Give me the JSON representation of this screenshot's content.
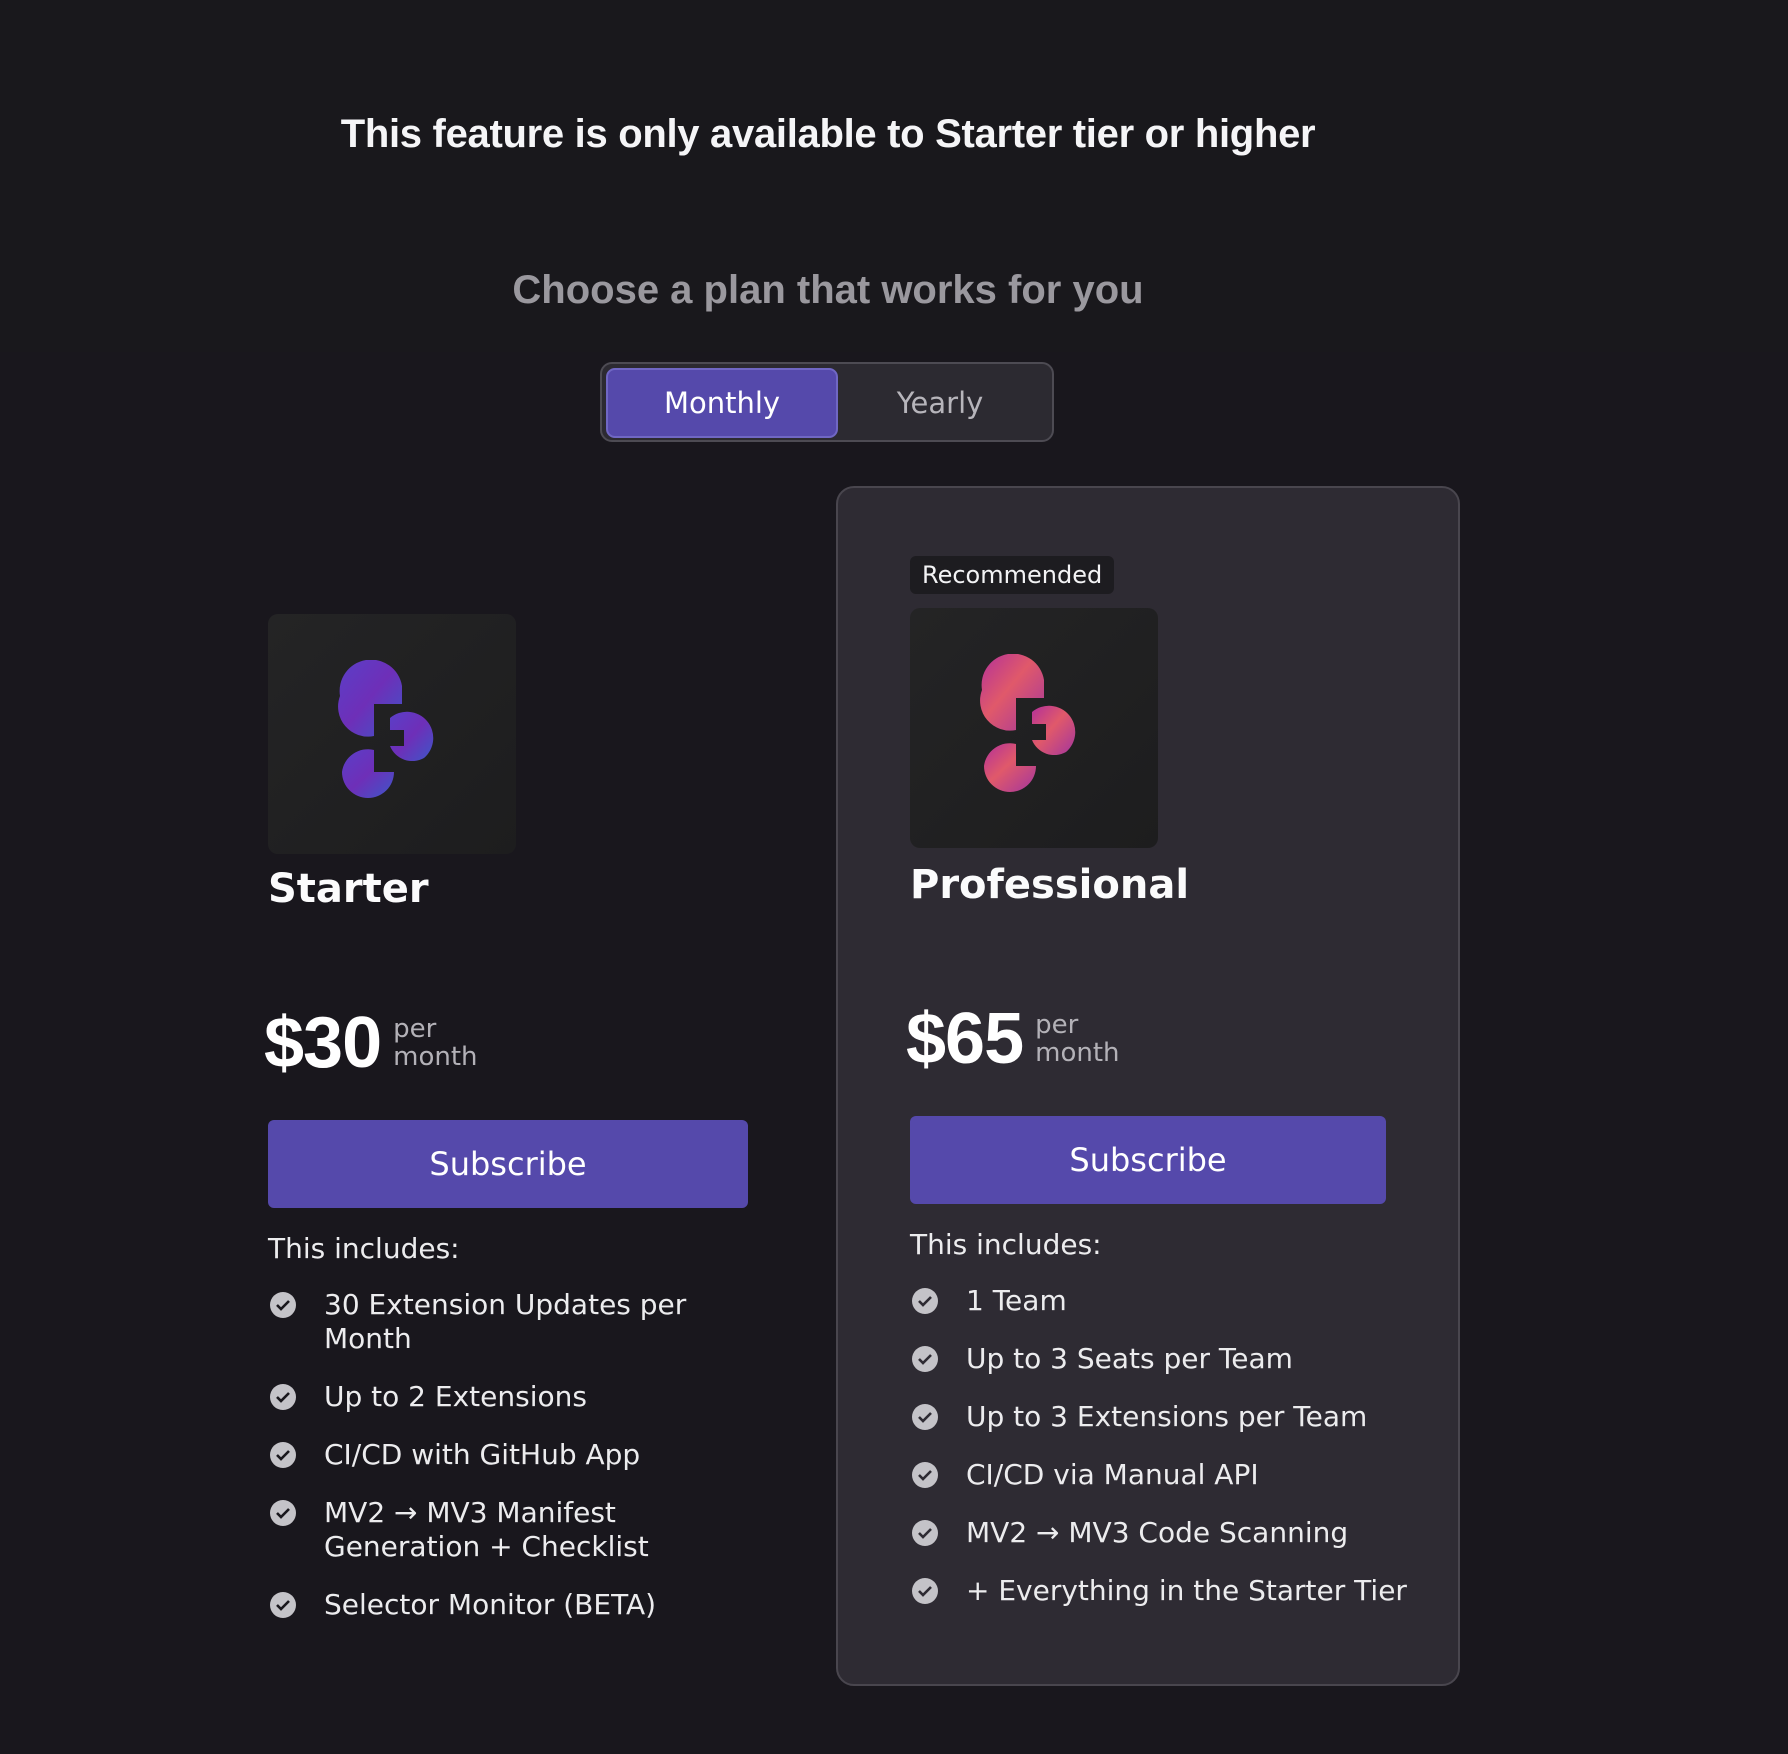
{
  "header": {
    "headline": "This feature is only available to Starter tier or higher",
    "subheadline": "Choose a plan that works for you"
  },
  "billing_toggle": {
    "options": [
      "Monthly",
      "Yearly"
    ],
    "selected": "Monthly"
  },
  "plans": [
    {
      "name": "Starter",
      "price": "$30",
      "unit": "per month",
      "cta": "Subscribe",
      "includes_label": "This includes:",
      "features": [
        "30 Extension Updates per Month",
        "Up to 2 Extensions",
        "CI/CD with GitHub App",
        "MV2 → MV3 Manifest Generation + Checklist",
        "Selector Monitor (BETA)"
      ]
    },
    {
      "name": "Professional",
      "badge": "Recommended",
      "price": "$65",
      "unit": "per month",
      "cta": "Subscribe",
      "includes_label": "This includes:",
      "features": [
        "1 Team",
        "Up to 3 Seats per Team",
        "Up to 3 Extensions per Team",
        "CI/CD via Manual API",
        "MV2 → MV3 Code Scanning",
        "+ Everything in the Starter Tier"
      ]
    }
  ],
  "colors": {
    "background": "#19171d",
    "accent": "#5549ab",
    "card": "#2e2b33",
    "muted_text": "#9a989e"
  },
  "icons": {
    "logo": "plasmo-logo-icon",
    "feature_bullet": "check-circle-icon"
  }
}
